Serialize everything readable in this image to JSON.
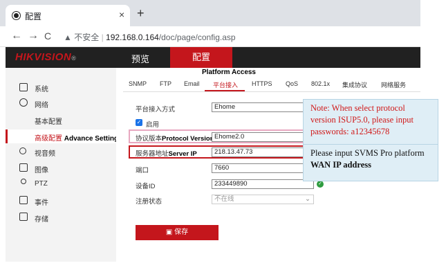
{
  "browser": {
    "tab_title": "配置",
    "tab_close": "×",
    "new_tab": "+",
    "back": "←",
    "forward": "→",
    "reload": "C",
    "insecure_label": "不安全",
    "url_host": "192.168.0.164",
    "url_path": "/doc/page/config.asp"
  },
  "app": {
    "logo_hik": "HIK",
    "logo_vision": "VISION",
    "logo_reg": "®",
    "nav": [
      {
        "label": "预览"
      },
      {
        "label": "配置"
      }
    ]
  },
  "sidebar": {
    "items": [
      {
        "label": "系统",
        "icon": "monitor-icon"
      },
      {
        "label": "网络",
        "icon": "globe-icon"
      },
      {
        "label": "基本配置",
        "icon": ""
      },
      {
        "label": "高级配置",
        "label_en": "Advance Settings",
        "icon": ""
      },
      {
        "label": "视音频",
        "icon": "audio-video-icon"
      },
      {
        "label": "图像",
        "icon": "image-icon"
      },
      {
        "label": "PTZ",
        "icon": "ptz-icon"
      },
      {
        "label": "事件",
        "icon": "calendar-icon"
      },
      {
        "label": "存储",
        "icon": "storage-icon"
      }
    ]
  },
  "main": {
    "section_title": "Platform Access",
    "tabs": [
      {
        "label": "SNMP"
      },
      {
        "label": "FTP"
      },
      {
        "label": "Email"
      },
      {
        "label": "平台接入"
      },
      {
        "label": "HTTPS"
      },
      {
        "label": "QoS"
      },
      {
        "label": "802.1x"
      },
      {
        "label": "集成协议"
      },
      {
        "label": "网络服务"
      }
    ],
    "form": {
      "access_mode_label": "平台接入方式",
      "access_mode_value": "Ehome",
      "enable_label": "启用",
      "protocol_label": "协议版本",
      "protocol_label_en": "Protocol Version",
      "protocol_value": "Ehome2.0",
      "server_label": "服务器地址",
      "server_label_en": "Server IP",
      "server_value": "218.13.47.73",
      "port_label": "端口",
      "port_value": "7660",
      "device_id_label": "设备ID",
      "device_id_value": "233449890",
      "reg_status_label": "注册状态",
      "reg_status_value": "不在线",
      "save_label": "保存"
    }
  },
  "callouts": {
    "note": "Note: When select protocol version ISUP5.0, please input passwords: a12345678",
    "tip_prefix": "Please input SVMS Pro platform ",
    "tip_bold": "WAN IP address"
  },
  "colors": {
    "brand_red": "#c4161c",
    "callout_bg": "#dfeef6",
    "note_text": "#d01818"
  }
}
